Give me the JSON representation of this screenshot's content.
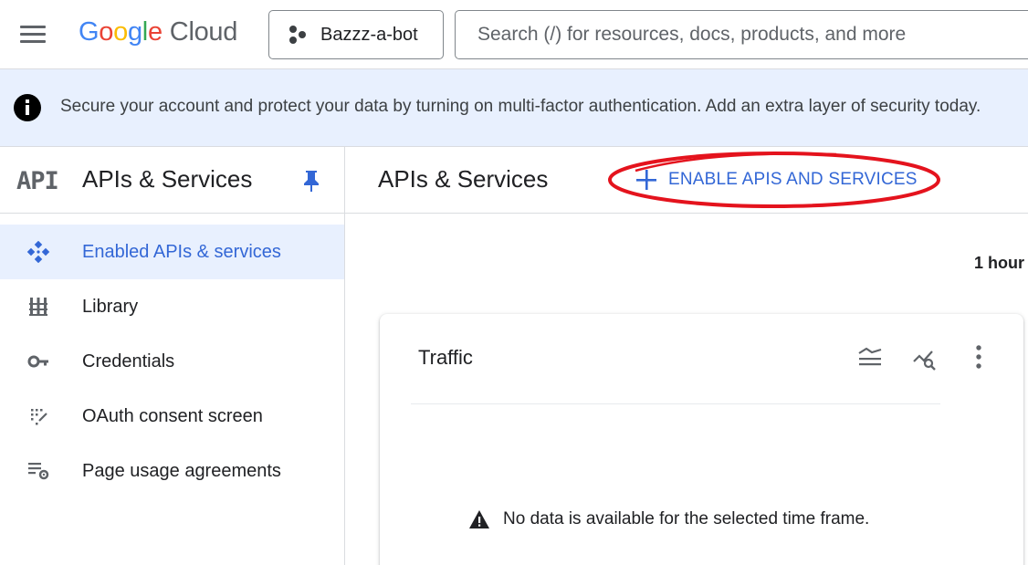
{
  "topbar": {
    "logo": {
      "letters": [
        "G",
        "o",
        "o",
        "g",
        "l",
        "e"
      ],
      "product": "Cloud"
    },
    "project": {
      "name": "Bazzz-a-bot",
      "icon": "project-dots-icon"
    },
    "search": {
      "placeholder": "Search (/) for resources, docs, products, and more",
      "value": ""
    }
  },
  "banner": {
    "icon": "info-icon",
    "text": "Secure your account and protect your data by turning on multi-factor authentication. Add an extra layer of security today."
  },
  "sidebar": {
    "glyph": "API",
    "title": "APIs & Services",
    "pin_icon": "pin-icon",
    "items": [
      {
        "label": "Enabled APIs & services",
        "icon": "enabled-apis-icon",
        "active": true
      },
      {
        "label": "Library",
        "icon": "library-icon",
        "active": false
      },
      {
        "label": "Credentials",
        "icon": "key-icon",
        "active": false
      },
      {
        "label": "OAuth consent screen",
        "icon": "oauth-icon",
        "active": false
      },
      {
        "label": "Page usage agreements",
        "icon": "settings-list-icon",
        "active": false
      }
    ]
  },
  "main": {
    "title": "APIs & Services",
    "enable_button": {
      "label": "ENABLE APIS AND SERVICES",
      "icon": "plus-icon"
    },
    "time_range": "1 hour",
    "card": {
      "title": "Traffic",
      "icons": [
        "legend-icon",
        "explore-icon",
        "more-vert-icon"
      ],
      "empty_message": "No data is available for the selected time frame."
    }
  },
  "colors": {
    "accent": "#3367d6",
    "banner_bg": "#e8f0fe",
    "annotation": "#e4131d",
    "google_blue": "#4285f4",
    "google_red": "#ea4335",
    "google_yellow": "#fbbc04",
    "google_green": "#34a853"
  }
}
